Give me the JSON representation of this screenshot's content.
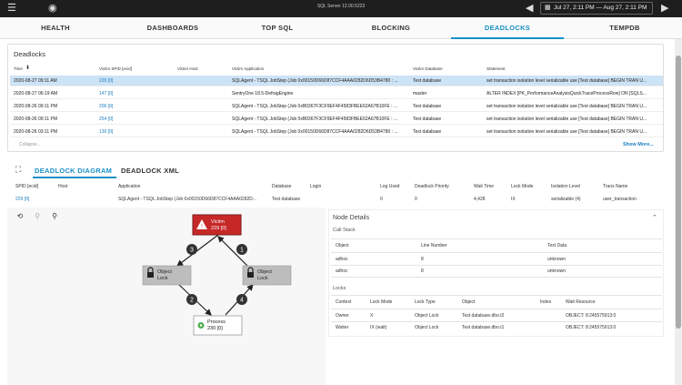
{
  "topbar": {
    "server_title": "SQL Server 12.00.5223",
    "date_range": "Jul 27, 2:11 PM — Aug 27, 2:11 PM",
    "icons": [
      "menu-icon",
      "logo-icon",
      "back-icon",
      "calendar-icon",
      "forward-icon"
    ]
  },
  "tabs": [
    "HEALTH",
    "DASHBOARDS",
    "TOP SQL",
    "BLOCKING",
    "DEADLOCKS",
    "TEMPDB"
  ],
  "deadlocks": {
    "title": "Deadlocks",
    "columns": [
      "Time",
      "Victim SPID [ecid]",
      "Victim Host",
      "Victim Application",
      "Victim Database",
      "Statement"
    ],
    "rows": [
      {
        "time": "2020-08-27 09:11 AM",
        "spid": "229 [0]",
        "host": "",
        "app": "SQLAgent - TSQL JobStep (Job 0x00150D66D87CCF4AAA0282D6D53B4780 : ...",
        "db": "Test database",
        "stmt": "set transaction isolation level serializable use [Test database] BEGIN TRAN U..."
      },
      {
        "time": "2020-08-27 06:19 AM",
        "spid": "147 [0]",
        "host": "",
        "app": "SentryOne 18.5-DefragEngine",
        "db": "master",
        "stmt": "ALTER INDEX [PK_PerformanceAnalysisQuickTraceProcessRow] ON [SQLS..."
      },
      {
        "time": "2020-08-26 09:11 PM",
        "spid": "206 [0]",
        "host": "",
        "app": "SQLAgent - TSQL JobStep (Job 0xB0367F3CF9EF4F4583FBEE62A67B10FE : ...",
        "db": "Test database",
        "stmt": "set transaction isolation level serializable use [Test database] BEGIN TRAN U..."
      },
      {
        "time": "2020-08-26 09:11 PM",
        "spid": "254 [0]",
        "host": "",
        "app": "SQLAgent - TSQL JobStep (Job 0xB0367F3CF9EF4F4583FBEE62A67B10FE : ...",
        "db": "Test database",
        "stmt": "set transaction isolation level serializable use [Test database] BEGIN TRAN U..."
      },
      {
        "time": "2020-08-26 03:11 PM",
        "spid": "130 [0]",
        "host": "",
        "app": "SQLAgent - TSQL JobStep (Job 0x00150D66D87CCF4AAA0282D6D53B4780 : ...",
        "db": "Test database",
        "stmt": "set transaction isolation level serializable use [Test database] BEGIN TRAN U..."
      }
    ],
    "collapse_label": "Collapse...",
    "show_more_label": "Show More..."
  },
  "subtabs": [
    "DEADLOCK DIAGRAM",
    "DEADLOCK XML"
  ],
  "detail": {
    "columns": [
      "SPID [ecid]",
      "Host",
      "Application",
      "Database",
      "Login",
      "Log Used",
      "Deadlock Priority",
      "Wait Time",
      "Lock Mode",
      "Isolation Level",
      "Trans Name"
    ],
    "values": [
      "229 [0]",
      "",
      "SQLAgent - TSQL JobStep (Job 0x00150D66D87CCF4AAA0282D...",
      "Test database",
      "",
      "0",
      "0",
      "4,428",
      "IX",
      "serializable (4)",
      "user_transaction"
    ]
  },
  "diagram": {
    "victim_label": "Victim",
    "victim_spid": "229 [0]",
    "object_label_1": "Object",
    "object_label_2": "Lock",
    "process_label": "Process",
    "process_spid": "230 [0]",
    "step_numbers": [
      "1",
      "2",
      "3",
      "4"
    ],
    "victim_color": "#c62828",
    "object_color": "#bdbdbd",
    "process_icon_color": "#4caf50"
  },
  "node_details": {
    "title": "Node Details",
    "call_stack_title": "Call Stack",
    "call_stack_columns": [
      "Object",
      "Line Number",
      "Text Data"
    ],
    "call_stack_rows": [
      [
        "adhoc",
        "8",
        "unknown"
      ],
      [
        "adhoc",
        "8",
        "unknown"
      ]
    ],
    "locks_title": "Locks",
    "locks_columns": [
      "Context",
      "Lock Mode",
      "Lock Type",
      "Object",
      "Index",
      "Wait Resource"
    ],
    "locks_rows": [
      [
        "Owner",
        "X",
        "Object Lock",
        "Test database.dbo.t2",
        "",
        "OBJECT: 8:245575913:0"
      ],
      [
        "Waiter",
        "IX (wait)",
        "Object Lock",
        "Test database.dbo.t1",
        "",
        "OBJECT: 8:245575913:0"
      ]
    ]
  },
  "colors": {
    "accent": "#1a8fc7",
    "selected_row": "#cde3f6",
    "link": "#1a7fc0"
  }
}
